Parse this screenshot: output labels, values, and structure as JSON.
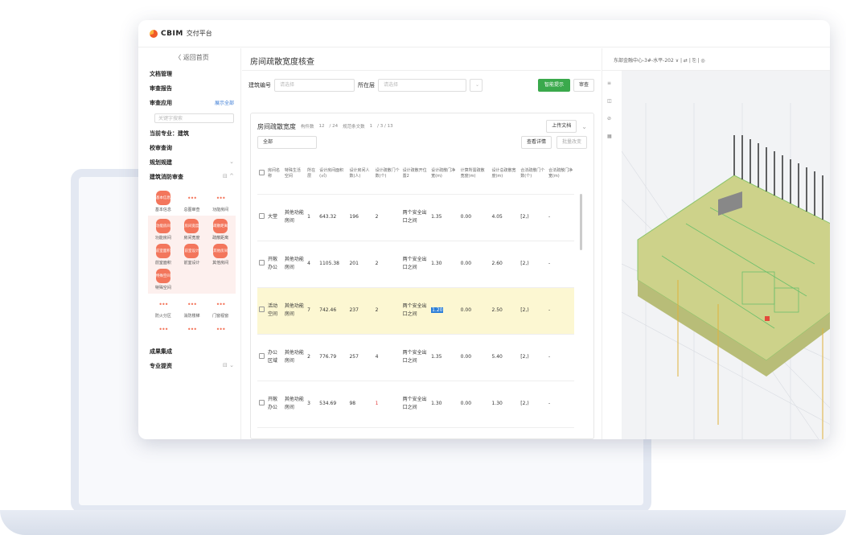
{
  "brand": {
    "logo": "CBIM",
    "subtitle": "交付平台"
  },
  "sidebar": {
    "back": "〈 返回首页",
    "items": [
      "文档管理",
      "审查报告",
      "审查应用"
    ],
    "show_all": "展示全部",
    "search_placeholder": "关键字搜索",
    "current_major": "当前专业：建筑",
    "school": "校审查询",
    "rules": "规划规建",
    "fire": "建筑消防审查",
    "tools1": [
      {
        "icon": "基本信息",
        "label": "基本信息",
        "dots": false
      },
      {
        "icon": "•••",
        "label": "总图审查",
        "dots": true
      },
      {
        "icon": "•••",
        "label": "功能房间",
        "dots": true
      }
    ],
    "tools2": [
      {
        "icon": "功能房间",
        "label": "功能房间"
      },
      {
        "icon": "房间宽度",
        "label": "房间宽度"
      },
      {
        "icon": "疏散距离",
        "label": "疏散距离"
      },
      {
        "icon": "前室面积",
        "label": "前室面积"
      },
      {
        "icon": "前室设计",
        "label": "前室设计"
      },
      {
        "icon": "其他房间",
        "label": "其他房间"
      },
      {
        "icon": "特殊空间",
        "label": "特殊空间"
      }
    ],
    "tools3": [
      {
        "label": "防火分区"
      },
      {
        "label": "消防楼梯"
      },
      {
        "label": "门窗视窗"
      },
      {
        "label": ""
      },
      {
        "label": ""
      },
      {
        "label": ""
      }
    ],
    "bottom1": "成果集成",
    "bottom2": "专业提资"
  },
  "main": {
    "title": "房间疏散宽度核查",
    "building_label": "建筑编号",
    "select_placeholder": "请选择",
    "floor_label": "所在层",
    "smart_button": "智能提示",
    "review_button": "审查",
    "card_title": "房间疏散宽度",
    "count_label": "构件数",
    "count_value": "12",
    "count_total": "/ 24",
    "norm_label": "规范条文数",
    "norm_value": "1",
    "norm_total": "/ 3 / 13",
    "upload_button": "上传文档",
    "filter_all": "全部",
    "detail_button": "查看详情",
    "batch_button": "批量改变",
    "columns": [
      "房间名称",
      "特殊生活空间",
      "所在层",
      "设计房间面积(㎡)",
      "设计房间人数(人)",
      "设计疏散门个数(个)",
      "设计疏散开位置2",
      "设计疏散门净宽(m)",
      "计算所需疏散宽度(m)",
      "设计总疏散宽度(m)",
      "合法疏散门个数(个)",
      "合法疏散门净宽(m)"
    ],
    "rows": [
      [
        "大堂",
        "其他功能房间",
        "1",
        "643.32",
        "196",
        "2",
        "两个安全出口之间",
        "1.35",
        "0.00",
        "4.05",
        "[2,)",
        "-"
      ],
      [
        "开敞办公",
        "其他功能房间",
        "4",
        "1105.38",
        "201",
        "2",
        "两个安全出口之间",
        "1.30",
        "0.00",
        "2.60",
        "[2,)",
        "-"
      ],
      [
        "活动空间",
        "其他功能房间",
        "7",
        "742.46",
        "237",
        "2",
        "两个安全出口之间",
        "1.20",
        "0.00",
        "2.50",
        "[2,)",
        "-"
      ],
      [
        "办公区域",
        "其他功能房间",
        "2",
        "776.79",
        "257",
        "4",
        "两个安全出口之间",
        "1.35",
        "0.00",
        "5.40",
        "[2,)",
        "-"
      ],
      [
        "开敞办公",
        "其他功能房间",
        "3",
        "534.69",
        "98",
        "1",
        "两个安全出口之间",
        "1.30",
        "0.00",
        "1.30",
        "[2,)",
        "-"
      ]
    ]
  },
  "viewer": {
    "title": "东部金融中心-3#-水平-202 ∨ | ⇄ | ⎘ | ◎"
  }
}
